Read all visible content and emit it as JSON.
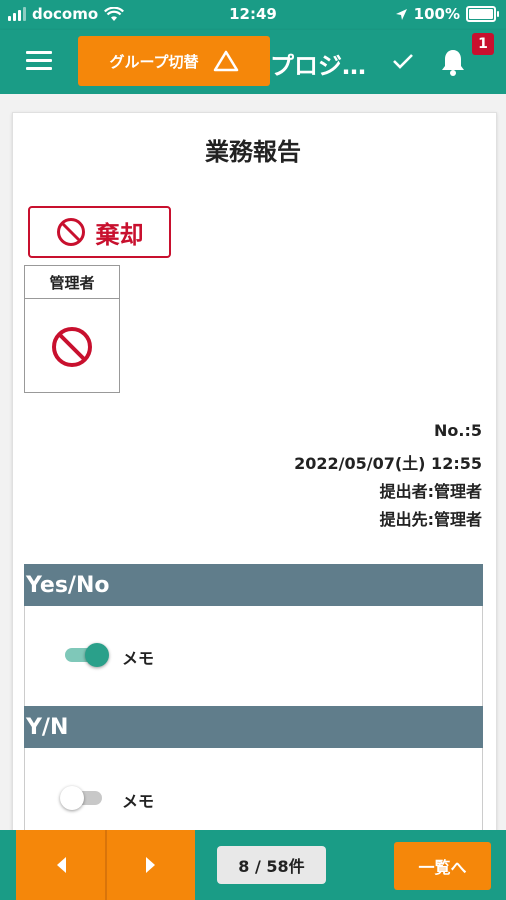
{
  "status_bar": {
    "carrier": "docomo",
    "time": "12:49",
    "battery": "100%",
    "icons": [
      "signal-icon",
      "wifi-icon",
      "location-arrow-icon",
      "battery-icon"
    ]
  },
  "app_bar": {
    "group_switch_label": "グループ切替",
    "title": "プロジ…",
    "notification_count": "1",
    "icons": [
      "menu-icon",
      "warning-triangle-icon",
      "check-icon",
      "bell-icon"
    ],
    "colors": {
      "primary": "#1a9c86",
      "accent": "#f5870a",
      "badge": "#c8102e"
    }
  },
  "report": {
    "title": "業務報告",
    "stamp_label": "棄却",
    "approver_label": "管理者",
    "number": "No.:5",
    "datetime": "2022/05/07(土) 12:55",
    "submitter": "提出者:管理者",
    "recipient": "提出先:管理者"
  },
  "sections": [
    {
      "title": "Yes/No",
      "memo": "メモ",
      "toggle_on": true
    },
    {
      "title": "Y/N",
      "memo": "メモ",
      "toggle_on": false
    }
  ],
  "bottom_bar": {
    "page_counter": "8 / 58件",
    "list_button": "一覧へ",
    "icons": [
      "prev-arrow-icon",
      "next-arrow-icon"
    ]
  }
}
